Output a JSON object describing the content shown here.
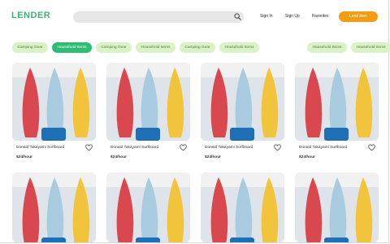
{
  "header": {
    "logo": "LENDER",
    "search": {
      "placeholder": ""
    },
    "nav": {
      "sign_in": "Sign In",
      "sign_up": "Sign Up",
      "favorites": "Favorites"
    },
    "lend_button": "Lend item"
  },
  "categories": [
    {
      "label": "Camping Gear",
      "active": false
    },
    {
      "label": "Household Items",
      "active": true
    },
    {
      "label": "Camping Gear",
      "active": false
    },
    {
      "label": "Household Items",
      "active": false
    },
    {
      "label": "Camping Gear",
      "active": false
    },
    {
      "label": "Household Items",
      "active": false
    },
    {
      "label": "Household Items",
      "active": false
    },
    {
      "label": "Household Items",
      "active": false
    }
  ],
  "listings": [
    {
      "title": "Donald Takayami Surfboard",
      "price": "$24/hour"
    },
    {
      "title": "Donald Takayami Surfboard",
      "price": "$24/hour"
    },
    {
      "title": "Donald Takayami Surfboard",
      "price": "$24/hour"
    },
    {
      "title": "Donald Takayami Surfboard",
      "price": "$24/hour"
    }
  ],
  "colors": {
    "brand": "#3cb371",
    "accent": "#f39c12",
    "chip": "#d9f2c6",
    "chip_active": "#2ebd73"
  }
}
